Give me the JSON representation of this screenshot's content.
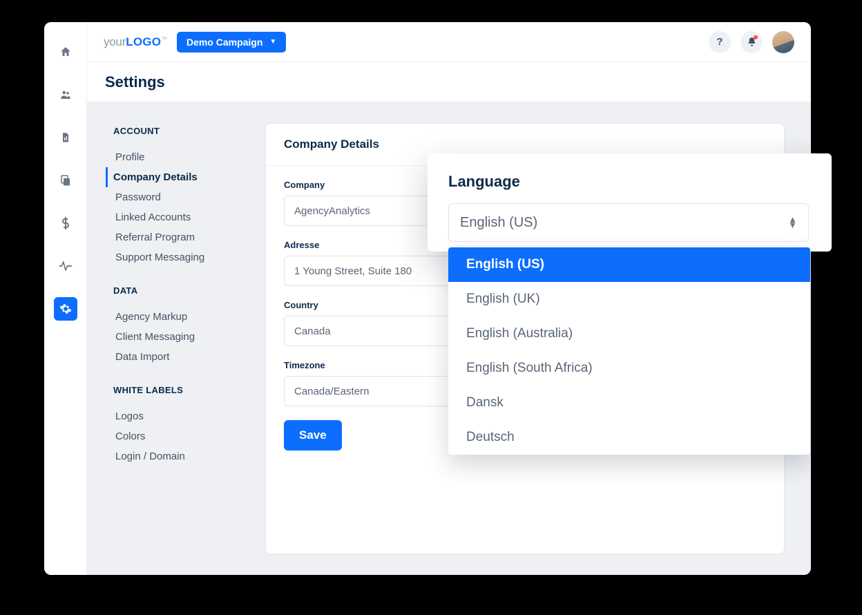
{
  "brand": {
    "part1": "your",
    "part2": "LOGO",
    "tm": "™"
  },
  "topbar": {
    "campaign_label": "Demo Campaign",
    "help_label": "?"
  },
  "page": {
    "title": "Settings"
  },
  "nav": {
    "sections": [
      {
        "heading": "ACCOUNT",
        "items": [
          {
            "label": "Profile"
          },
          {
            "label": "Company Details",
            "active": true
          },
          {
            "label": "Password"
          },
          {
            "label": "Linked Accounts"
          },
          {
            "label": "Referral Program"
          },
          {
            "label": "Support Messaging"
          }
        ]
      },
      {
        "heading": "DATA",
        "items": [
          {
            "label": "Agency Markup"
          },
          {
            "label": "Client Messaging"
          },
          {
            "label": "Data Import"
          }
        ]
      },
      {
        "heading": "WHITE LABELS",
        "items": [
          {
            "label": "Logos"
          },
          {
            "label": "Colors"
          },
          {
            "label": "Login / Domain"
          }
        ]
      }
    ]
  },
  "panel": {
    "title": "Company Details",
    "fields": {
      "company": {
        "label": "Company",
        "value": "AgencyAnalytics"
      },
      "address": {
        "label": "Adresse",
        "value": "1 Young Street, Suite 180"
      },
      "country": {
        "label": "Country",
        "value": "Canada"
      },
      "timezone": {
        "label": "Timezone",
        "value": "Canada/Eastern"
      }
    },
    "save_label": "Save"
  },
  "language_popover": {
    "title": "Language",
    "selected": "English (US)",
    "options": [
      "English (US)",
      "English (UK)",
      "English (Australia)",
      "English (South Africa)",
      "Dansk",
      "Deutsch"
    ]
  },
  "rail_icons": [
    {
      "name": "home-icon"
    },
    {
      "name": "users-icon"
    },
    {
      "name": "file-icon"
    },
    {
      "name": "copy-icon"
    },
    {
      "name": "dollar-icon"
    },
    {
      "name": "activity-icon"
    },
    {
      "name": "gear-icon",
      "active": true
    }
  ]
}
